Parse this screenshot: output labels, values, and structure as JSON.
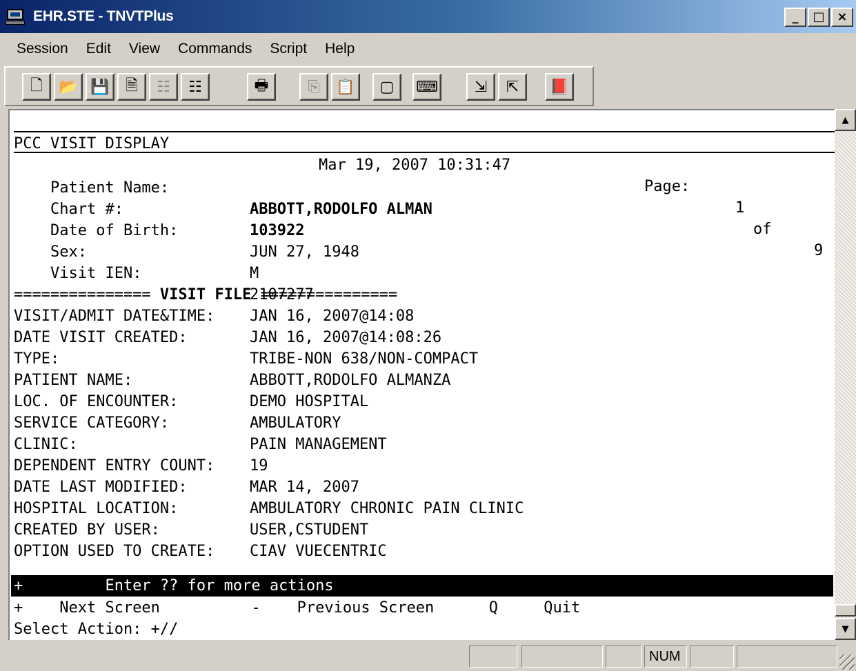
{
  "window": {
    "title": "EHR.STE - TNVTPlus",
    "minimize": "_",
    "maximize": "□",
    "close": "×"
  },
  "menu": [
    "Session",
    "Edit",
    "View",
    "Commands",
    "Script",
    "Help"
  ],
  "toolbar": {
    "groups": [
      [
        "new-file-icon",
        "open-folder-icon",
        "save-icon",
        "properties-icon",
        "disabled-settings-icon",
        "settings-icon"
      ],
      [
        "print-icon"
      ],
      [
        "copy-icon",
        "paste-icon"
      ],
      [
        "window-icon"
      ],
      [
        "keyboard-icon"
      ],
      [
        "import-icon",
        "export-icon"
      ],
      [
        "help-book-icon"
      ]
    ]
  },
  "terminal": {
    "header": {
      "title": "PCC VISIT DISPLAY",
      "datetime": "Mar 19, 2007 10:31:47",
      "page_label": "Page:",
      "page_current": "1",
      "page_of": "of",
      "page_total": "9"
    },
    "patient": [
      {
        "label": "Patient Name:",
        "value": "ABBOTT,RODOLFO ALMAN"
      },
      {
        "label": "Chart #:",
        "value": "103922"
      },
      {
        "label": "Date of Birth:",
        "value": "JUN 27, 1948"
      },
      {
        "label": "Sex:",
        "value": "M"
      },
      {
        "label": "Visit IEN:",
        "value": "2107277"
      }
    ],
    "section_left": "=============== ",
    "section_title": "VISIT FILE",
    "section_right": " ===============",
    "visit": [
      {
        "label": "VISIT/ADMIT DATE&TIME:",
        "value": "JAN 16, 2007@14:08"
      },
      {
        "label": "DATE VISIT CREATED:",
        "value": "JAN 16, 2007@14:08:26"
      },
      {
        "label": "TYPE:",
        "value": "TRIBE-NON 638/NON-COMPACT"
      },
      {
        "label": "PATIENT NAME:",
        "value": "ABBOTT,RODOLFO ALMANZA"
      },
      {
        "label": "LOC. OF ENCOUNTER:",
        "value": "DEMO HOSPITAL"
      },
      {
        "label": "SERVICE CATEGORY:",
        "value": "AMBULATORY"
      },
      {
        "label": "CLINIC:",
        "value": "PAIN MANAGEMENT"
      },
      {
        "label": "DEPENDENT ENTRY COUNT:",
        "value": "19"
      },
      {
        "label": "DATE LAST MODIFIED:",
        "value": "MAR 14, 2007"
      },
      {
        "label": "HOSPITAL LOCATION:",
        "value": "AMBULATORY CHRONIC PAIN CLINIC"
      },
      {
        "label": "CREATED BY USER:",
        "value": "USER,CSTUDENT"
      },
      {
        "label": "OPTION USED TO CREATE:",
        "value": "CIAV VUECENTRIC"
      }
    ],
    "action_bar": "+         Enter ?? for more actions",
    "actions_line": "+    Next Screen          -    Previous Screen      Q     Quit",
    "prompt": "Select Action: +//"
  },
  "statusbar": {
    "num": "NUM"
  }
}
